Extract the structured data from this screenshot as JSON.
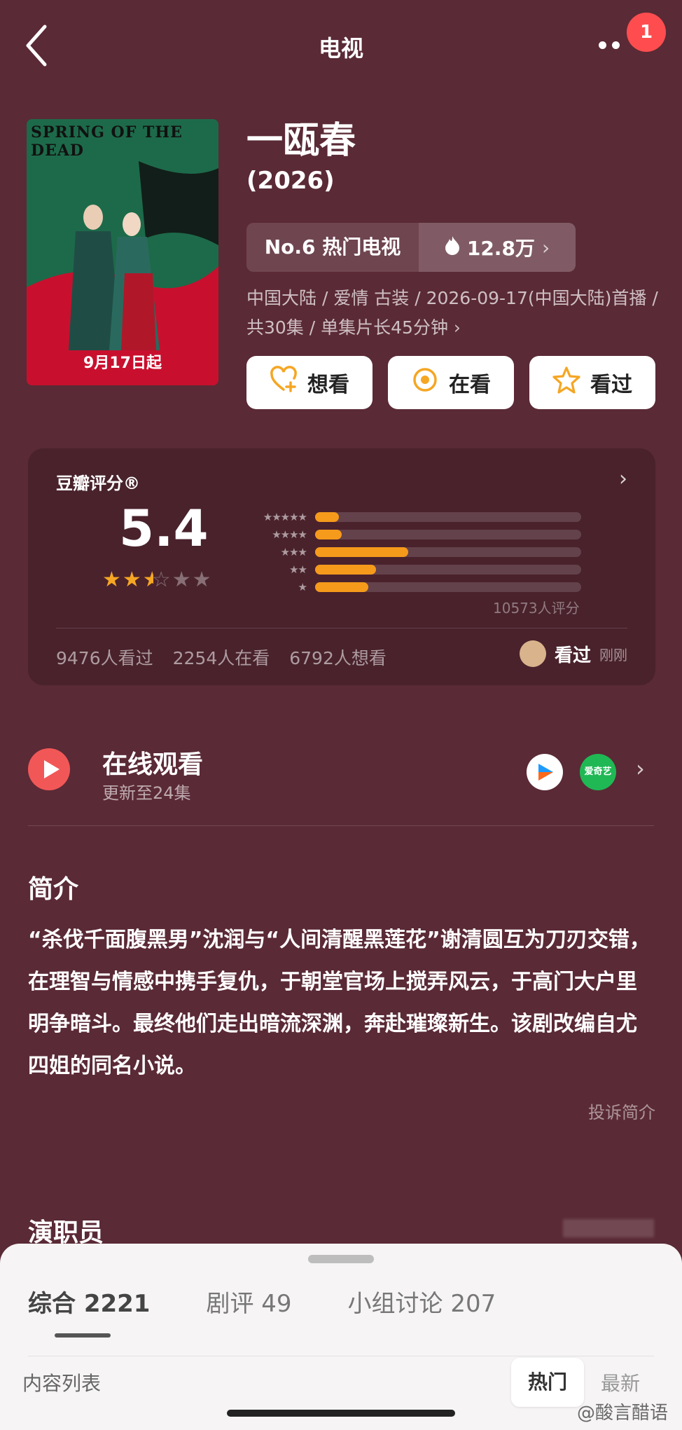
{
  "header": {
    "title": "电视",
    "badge": "1"
  },
  "show": {
    "name": "一瓯春",
    "year": "(2026)",
    "poster_title": "SPRING OF THE DEAD",
    "poster_date": "9月17日起",
    "rank": "No.6 热门电视",
    "heat": "12.8万",
    "meta": "中国大陆 / 爱情 古装 / 2026-09-17(中国大陆)首播 / 共30集 / 单集片长45分钟 ›"
  },
  "actions": [
    {
      "label": "想看",
      "icon": "heart-plus-icon"
    },
    {
      "label": "在看",
      "icon": "target-icon"
    },
    {
      "label": "看过",
      "icon": "star-icon"
    }
  ],
  "rating": {
    "title": "豆瓣评分®",
    "score": "5.4",
    "stars": 2.5,
    "distribution": [
      {
        "stars": "★★★★★",
        "pct": 9
      },
      {
        "stars": "★★★★",
        "pct": 10
      },
      {
        "stars": "★★★",
        "pct": 35
      },
      {
        "stars": "★★",
        "pct": 23
      },
      {
        "stars": "★",
        "pct": 20
      }
    ],
    "count": "10573人评分",
    "watched": "9476人看过",
    "watching": "2254人在看",
    "want": "6792人想看",
    "user_label": "看过",
    "user_time": "刚刚"
  },
  "watch": {
    "title": "在线观看",
    "subtitle": "更新至24集",
    "platform2": "爱奇艺"
  },
  "intro": {
    "heading": "简介",
    "text": "“杀伐千面腹黑男”沈润与“人间清醒黑莲花”谢清圆互为刀刃交错，在理智与情感中携手复仇，于朝堂官场上搅弄风云，于高门大户里明争暗斗。最终他们走出暗流深渊，奔赴璀璨新生。该剧改编自尤四姐的同名小说。",
    "report": "投诉简介"
  },
  "cast": {
    "heading": "演职员"
  },
  "sheet": {
    "tabs": [
      "综合 2221",
      "剧评 49",
      "小组讨论 207"
    ],
    "list_title": "内容列表",
    "sort_hot": "热门",
    "sort_new": "最新"
  },
  "watermark": "@酸言醋语",
  "colors": {
    "bg": "#5a2a36",
    "accent": "#f59a1b",
    "play": "#f25757",
    "badge": "#ff4d4f"
  }
}
